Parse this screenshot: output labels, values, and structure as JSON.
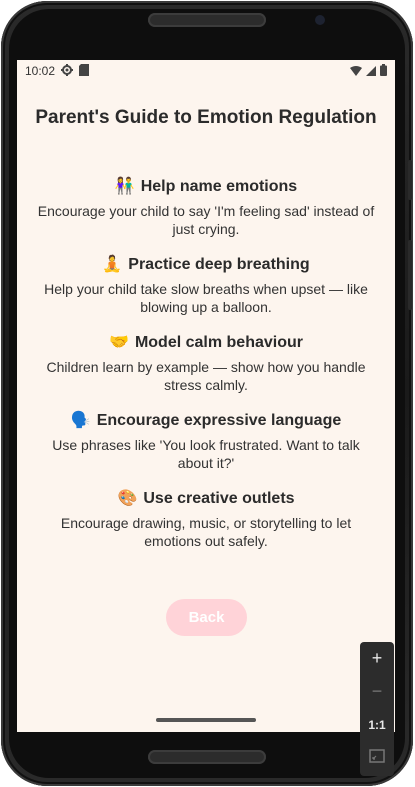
{
  "status_bar": {
    "time": "10:02",
    "icons": [
      "gear-icon",
      "sd-card-icon",
      "wifi-icon",
      "signal-icon",
      "battery-icon"
    ]
  },
  "page": {
    "title": "Parent's Guide to Emotion Regulation"
  },
  "tips": [
    {
      "icon": "👫",
      "heading": "Help name emotions",
      "body": "Encourage your child to say 'I'm feeling sad' instead of just crying."
    },
    {
      "icon": "🧘",
      "heading": "Practice deep breathing",
      "body": "Help your child take slow breaths when upset — like blowing up a balloon."
    },
    {
      "icon": "🤝",
      "heading": "Model calm behaviour",
      "body": "Children learn by example — show how you handle stress calmly."
    },
    {
      "icon": "🗣️",
      "heading": "Encourage expressive language",
      "body": "Use phrases like 'You look frustrated. Want to talk about it?'"
    },
    {
      "icon": "🎨",
      "heading": "Use creative outlets",
      "body": "Encourage drawing, music, or storytelling to let emotions out safely."
    }
  ],
  "back_button": {
    "label": "Back"
  },
  "zoom_controls": {
    "zoom_in": "+",
    "zoom_out": "−",
    "ratio": "1:1"
  },
  "colors": {
    "screen_background": "#fdf5ee",
    "back_button": "#ffd3d8",
    "text": "#2b2b2b"
  }
}
